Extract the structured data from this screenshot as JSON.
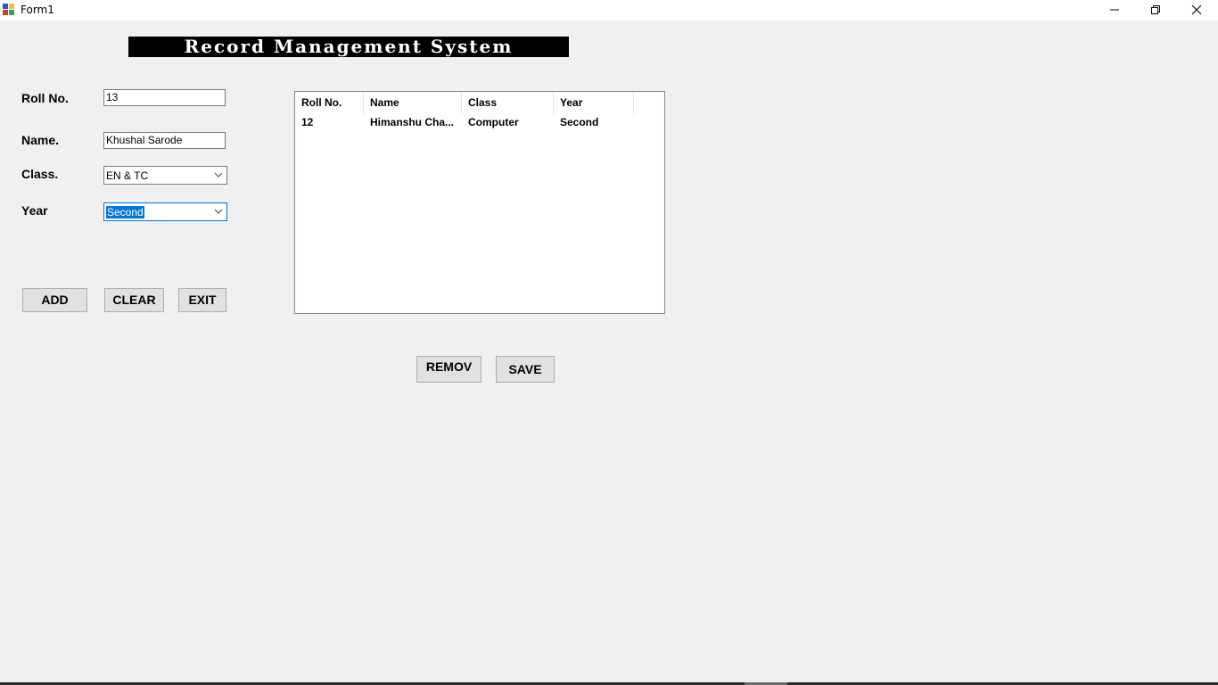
{
  "window": {
    "title": "Form1",
    "controls": {
      "minimize_icon": "minimize-icon",
      "maximize_icon": "restore-icon",
      "close_icon": "close-icon"
    }
  },
  "banner": {
    "title": "Record Management System"
  },
  "form": {
    "roll_label": "Roll No.",
    "roll_value": "13",
    "name_label": "Name.",
    "name_value": "Khushal Sarode",
    "class_label": "Class.",
    "class_value": "EN & TC",
    "year_label": "Year",
    "year_value": "Second"
  },
  "buttons": {
    "add": "ADD",
    "clear": "CLEAR",
    "exit": "EXIT",
    "remove": "REMOV",
    "save": "SAVE"
  },
  "list": {
    "columns": [
      "Roll No.",
      "Name",
      "Class",
      "Year"
    ],
    "rows": [
      [
        "12",
        "Himanshu Cha...",
        "Computer",
        "Second"
      ]
    ]
  },
  "colors": {
    "window_bg": "#f0f0f0",
    "banner_bg": "#000000",
    "banner_text": "#ffffff",
    "selection": "#0078d7",
    "button_bg": "#e1e1e1"
  }
}
